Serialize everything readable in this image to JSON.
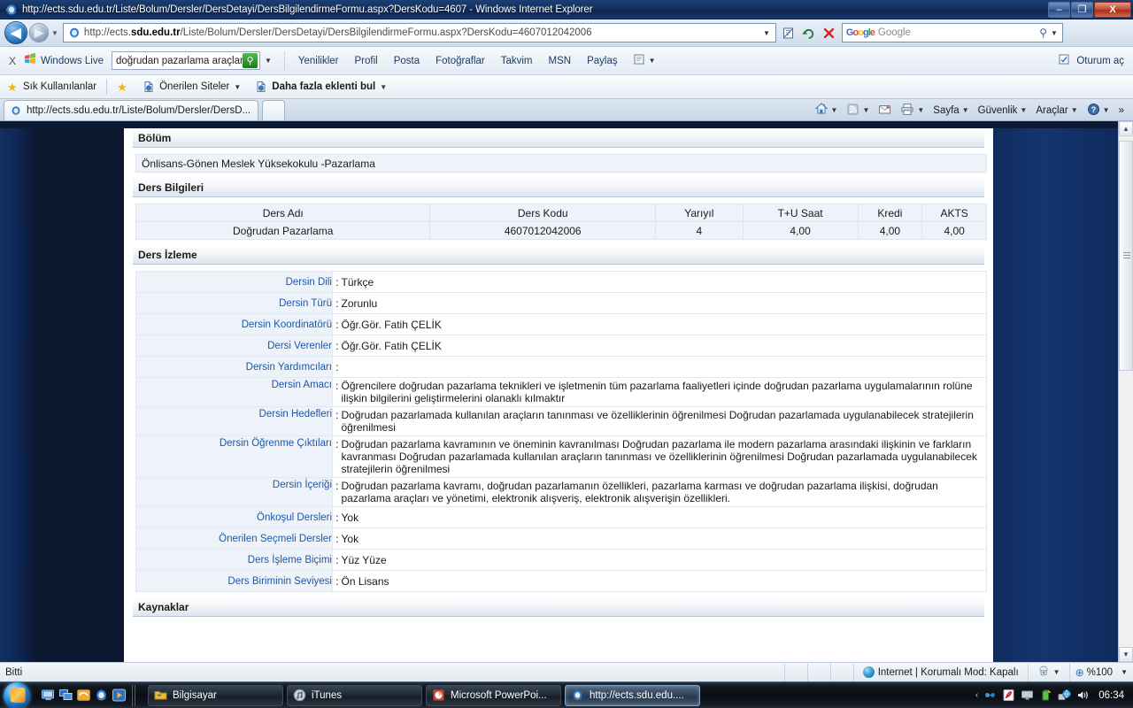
{
  "window": {
    "title": "http://ects.sdu.edu.tr/Liste/Bolum/Dersler/DersDetayi/DersBilgilendirmeFormu.aspx?DersKodu=4607 - Windows Internet Explorer",
    "minimize_label": "–",
    "maximize_label": "❐",
    "close_label": "X"
  },
  "address_bar": {
    "url_prefix": "http://ects.",
    "url_domain": "sdu.edu.tr",
    "url_suffix": "/Liste/Bolum/Dersler/DersDetayi/DersBilgilendirmeFormu.aspx?DersKodu=4607012042006",
    "dropdown_caret": "▼",
    "refresh_label": "↻",
    "stop_label": "✕",
    "compat_label": "▤",
    "search_placeholder": "Google",
    "search_caret": "▼",
    "search_icon": "⚲",
    "back_label": "◀",
    "forward_label": "▶",
    "history_caret": "▼"
  },
  "live_toolbar": {
    "close_label": "X",
    "brand": "Windows Live",
    "search_value": "doğrudan pazarlama araçları",
    "search_button": "⚲",
    "search_caret": "▼",
    "links": [
      "Yenilikler",
      "Profil",
      "Posta",
      "Fotoğraflar",
      "Takvim",
      "MSN",
      "Paylaş"
    ],
    "panel_caret": "▼",
    "signin_label": "Oturum aç"
  },
  "favorites_bar": {
    "favorites_label": "Sık Kullanılanlar",
    "suggested_sites": "Önerilen Siteler",
    "more_addons": "Daha fazla eklenti bul",
    "caret": "▼"
  },
  "tabs": {
    "items": [
      {
        "label": "http://ects.sdu.edu.tr/Liste/Bolum/Dersler/DersD..."
      }
    ],
    "new_tab_label": ""
  },
  "command_bar": {
    "home_caret": "▼",
    "feeds_caret": "▼",
    "print_caret": "▼",
    "page_label": "Sayfa",
    "safety_label": "Güvenlik",
    "tools_label": "Araçlar",
    "help_caret": "▼",
    "overflow_label": "»"
  },
  "page": {
    "sections": {
      "bolum_header": "Bölüm",
      "bolum_value": "Önlisans-Gönen Meslek Yüksekokulu -Pazarlama",
      "ders_bilgileri_header": "Ders Bilgileri",
      "ders_izleme_header": "Ders İzleme",
      "kaynaklar_header": "Kaynaklar"
    },
    "course_table": {
      "headers": [
        "Ders Adı",
        "Ders Kodu",
        "Yarıyıl",
        "T+U Saat",
        "Kredi",
        "AKTS"
      ],
      "rows": [
        [
          "Doğrudan Pazarlama",
          "4607012042006",
          "4",
          "4,00",
          "4,00",
          "4,00"
        ]
      ]
    },
    "details": [
      {
        "label": "Dersin Dili",
        "value": "Türkçe",
        "multiline": false
      },
      {
        "label": "Dersin Türü",
        "value": "Zorunlu",
        "multiline": false
      },
      {
        "label": "Dersin Koordinatörü",
        "value": "Öğr.Gör. Fatih ÇELİK",
        "multiline": false
      },
      {
        "label": "Dersi Verenler",
        "value": "Öğr.Gör. Fatih ÇELİK",
        "multiline": false
      },
      {
        "label": "Dersin Yardımcıları",
        "value": "",
        "multiline": false
      },
      {
        "label": "Dersin Amacı",
        "value": "Öğrencilere doğrudan pazarlama teknikleri ve işletmenin tüm pazarlama faaliyetleri içinde doğrudan pazarlama uygulamalarının rolüne ilişkin bilgilerini geliştirmelerini olanaklı kılmaktır",
        "multiline": true
      },
      {
        "label": "Dersin Hedefleri",
        "value": "Doğrudan pazarlamada kullanılan araçların tanınması ve özelliklerinin öğrenilmesi Doğrudan pazarlamada uygulanabilecek stratejilerin öğrenilmesi",
        "multiline": true
      },
      {
        "label": "Dersin Öğrenme Çıktıları",
        "value": "Doğrudan pazarlama kavramının ve öneminin kavranılması Doğrudan pazarlama ile modern pazarlama arasındaki ilişkinin ve farkların kavranması Doğrudan pazarlamada kullanılan araçların tanınması ve özelliklerinin öğrenilmesi Doğrudan pazarlamada uygulanabilecek stratejilerin öğrenilmesi",
        "multiline": true
      },
      {
        "label": "Dersin İçeriği",
        "value": "Doğrudan pazarlama kavramı, doğrudan pazarlamanın özellikleri, pazarlama karması ve doğrudan pazarlama ilişkisi, doğrudan pazarlama araçları ve yönetimi, elektronik alışveriş, elektronik alışverişin özellikleri.",
        "multiline": true
      },
      {
        "label": "Önkoşul Dersleri",
        "value": "Yok",
        "multiline": false
      },
      {
        "label": "Önerilen Seçmeli Dersler",
        "value": "Yok",
        "multiline": false
      },
      {
        "label": "Ders İşleme Biçimi",
        "value": "Yüz Yüze",
        "multiline": false
      },
      {
        "label": "Ders Biriminin Seviyesi",
        "value": "Ön Lisans",
        "multiline": false
      }
    ],
    "colon": ":"
  },
  "status_bar": {
    "status_text": "Bitti",
    "zone_text": "Internet | Korumalı Mod: Kapalı",
    "protected_caret": "▼",
    "zoom_label": "%100",
    "zoom_caret": "▼",
    "zoom_icon": "⊕"
  },
  "taskbar": {
    "start_label": "",
    "quick_launch": [
      "show-desktop-icon",
      "switch-window-icon",
      "windows-media-icon",
      "internet-explorer-icon",
      "media-player-icon"
    ],
    "tasks": [
      {
        "label": "Bilgisayar",
        "active": false
      },
      {
        "label": "iTunes",
        "active": false
      },
      {
        "label": "Microsoft PowerPoi...",
        "active": false
      },
      {
        "label": "http://ects.sdu.edu....",
        "active": true
      }
    ],
    "tray_caret": "‹",
    "clock": "06:34"
  },
  "colors": {
    "title_blue": "#13305f",
    "page_navy": "#0c1730",
    "label_blue": "#1f56a8",
    "table_bg": "#eef3fa",
    "accent_green": "#1d7a1d"
  }
}
